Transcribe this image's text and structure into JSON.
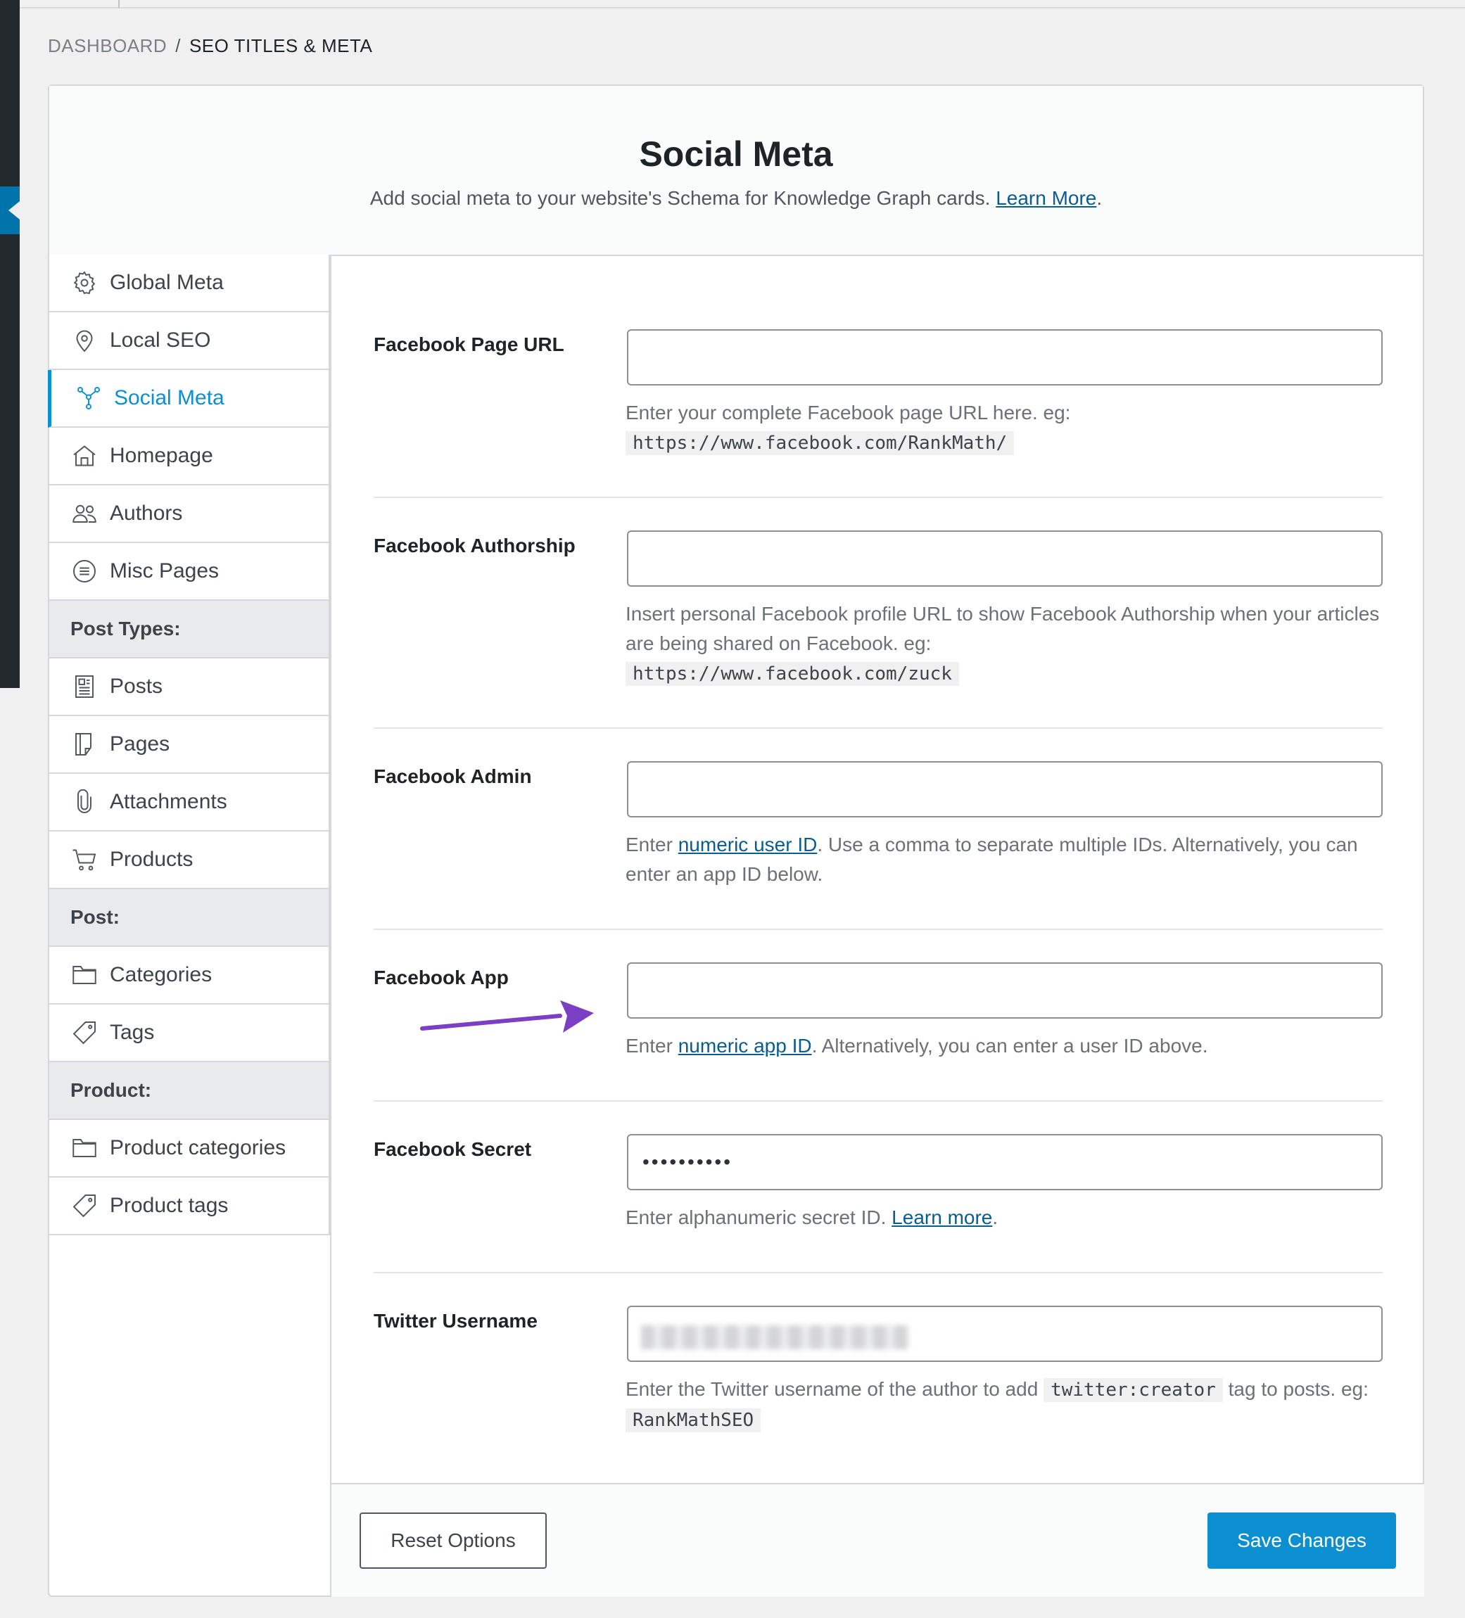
{
  "breadcrumb": {
    "root": "DASHBOARD",
    "separator": "/",
    "current": "SEO TITLES & META"
  },
  "header": {
    "title": "Social Meta",
    "description": "Add social meta to your website's Schema for Knowledge Graph cards.",
    "learn_more": "Learn More",
    "period": "."
  },
  "sidebar": {
    "items": [
      {
        "label": "Global Meta",
        "icon": "gear-icon"
      },
      {
        "label": "Local SEO",
        "icon": "map-pin-icon"
      },
      {
        "label": "Social Meta",
        "icon": "share-network-icon"
      },
      {
        "label": "Homepage",
        "icon": "home-icon"
      },
      {
        "label": "Authors",
        "icon": "users-icon"
      },
      {
        "label": "Misc Pages",
        "icon": "list-circle-icon"
      }
    ],
    "post_types_heading": "Post Types:",
    "post_types": [
      {
        "label": "Posts",
        "icon": "document-icon"
      },
      {
        "label": "Pages",
        "icon": "page-icon"
      },
      {
        "label": "Attachments",
        "icon": "paperclip-icon"
      },
      {
        "label": "Products",
        "icon": "cart-icon"
      }
    ],
    "post_heading": "Post:",
    "post_items": [
      {
        "label": "Categories",
        "icon": "folder-icon"
      },
      {
        "label": "Tags",
        "icon": "tag-icon"
      }
    ],
    "product_heading": "Product:",
    "product_items": [
      {
        "label": "Product categories",
        "icon": "folder-icon"
      },
      {
        "label": "Product tags",
        "icon": "tag-icon"
      }
    ]
  },
  "fields": {
    "facebook_page_url": {
      "label": "Facebook Page URL",
      "value": "",
      "help": "Enter your complete Facebook page URL here. eg:",
      "example": "https://www.facebook.com/RankMath/"
    },
    "facebook_authorship": {
      "label": "Facebook Authorship",
      "value": "",
      "help": "Insert personal Facebook profile URL to show Facebook Authorship when your articles are being shared on Facebook. eg:",
      "example": "https://www.facebook.com/zuck"
    },
    "facebook_admin": {
      "label": "Facebook Admin",
      "value": "",
      "help_prefix": "Enter",
      "help_link": "numeric user ID",
      "help_suffix": ". Use a comma to separate multiple IDs. Alternatively, you can enter an app ID below."
    },
    "facebook_app": {
      "label": "Facebook App",
      "value": "",
      "help_prefix": "Enter",
      "help_link": "numeric app ID",
      "help_suffix": ". Alternatively, you can enter a user ID above."
    },
    "facebook_secret": {
      "label": "Facebook Secret",
      "value": "••••••••••",
      "help_prefix": "Enter alphanumeric secret ID.",
      "help_link": "Learn more",
      "help_suffix": "."
    },
    "twitter_username": {
      "label": "Twitter Username",
      "value": "",
      "help_prefix": "Enter the Twitter username of the author to add",
      "code_tag": "twitter:creator",
      "help_middle": "tag to posts. eg:",
      "example": "RankMathSEO"
    }
  },
  "footer": {
    "reset_label": "Reset Options",
    "save_label": "Save Changes"
  },
  "colors": {
    "accent": "#0b8fd1",
    "link": "#0a5d8f",
    "annotation_arrow": "#7b3fc4"
  }
}
